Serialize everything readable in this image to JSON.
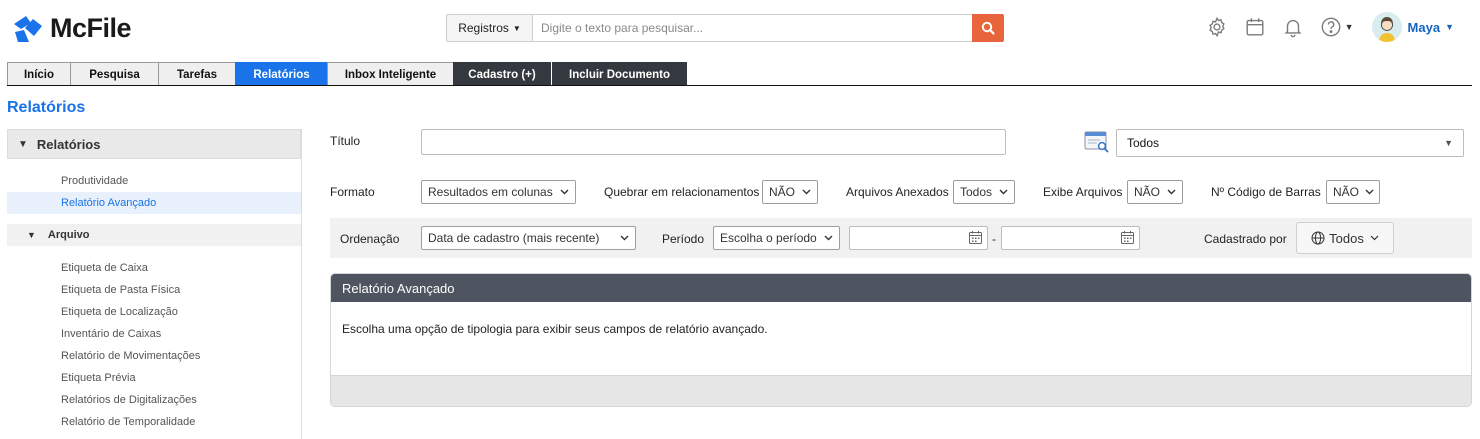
{
  "app": {
    "name": "McFile"
  },
  "search": {
    "scope": "Registros",
    "placeholder": "Digite o texto para pesquisar..."
  },
  "user": {
    "name": "Maya"
  },
  "tabs": [
    {
      "label": "Início"
    },
    {
      "label": "Pesquisa"
    },
    {
      "label": "Tarefas"
    },
    {
      "label": "Relatórios"
    },
    {
      "label": "Inbox Inteligente"
    },
    {
      "label": "Cadastro (+)"
    },
    {
      "label": "Incluir Documento"
    }
  ],
  "page": {
    "title": "Relatórios"
  },
  "sidebar": {
    "header": "Relatórios",
    "items": [
      "Produtividade",
      "Relatório Avançado"
    ],
    "section": "Arquivo",
    "section_items": [
      "Etiqueta de Caixa",
      "Etiqueta de Pasta Física",
      "Etiqueta de Localização",
      "Inventário de Caixas",
      "Relatório de Movimentações",
      "Etiqueta Prévia",
      "Relatórios de Digitalizações",
      "Relatório de Temporalidade"
    ]
  },
  "form": {
    "titulo_label": "Título",
    "titulo_value": "",
    "tipologia_value": "Todos",
    "formato_label": "Formato",
    "formato_value": "Resultados em colunas",
    "quebrar_label": "Quebrar em relacionamentos",
    "quebrar_value": "NÃO",
    "anexados_label": "Arquivos Anexados",
    "anexados_value": "Todos",
    "exibe_label": "Exibe Arquivos",
    "exibe_value": "NÃO",
    "barras_label": "Nº Código de Barras",
    "barras_value": "NÃO",
    "ordenacao_label": "Ordenação",
    "ordenacao_value": "Data de cadastro (mais recente)",
    "periodo_label": "Período",
    "periodo_value": "Escolha o período",
    "date_separator": "-",
    "cadastrado_label": "Cadastrado por",
    "cadastrado_value": "Todos"
  },
  "panel": {
    "title": "Relatório Avançado",
    "message": "Escolha uma opção de tipologia para exibir seus campos de relatório avançado."
  },
  "colors": {
    "accent": "#1a73e8",
    "search_button": "#e8643a",
    "dark_tab": "#34393f",
    "panel_header": "#4f5560"
  }
}
